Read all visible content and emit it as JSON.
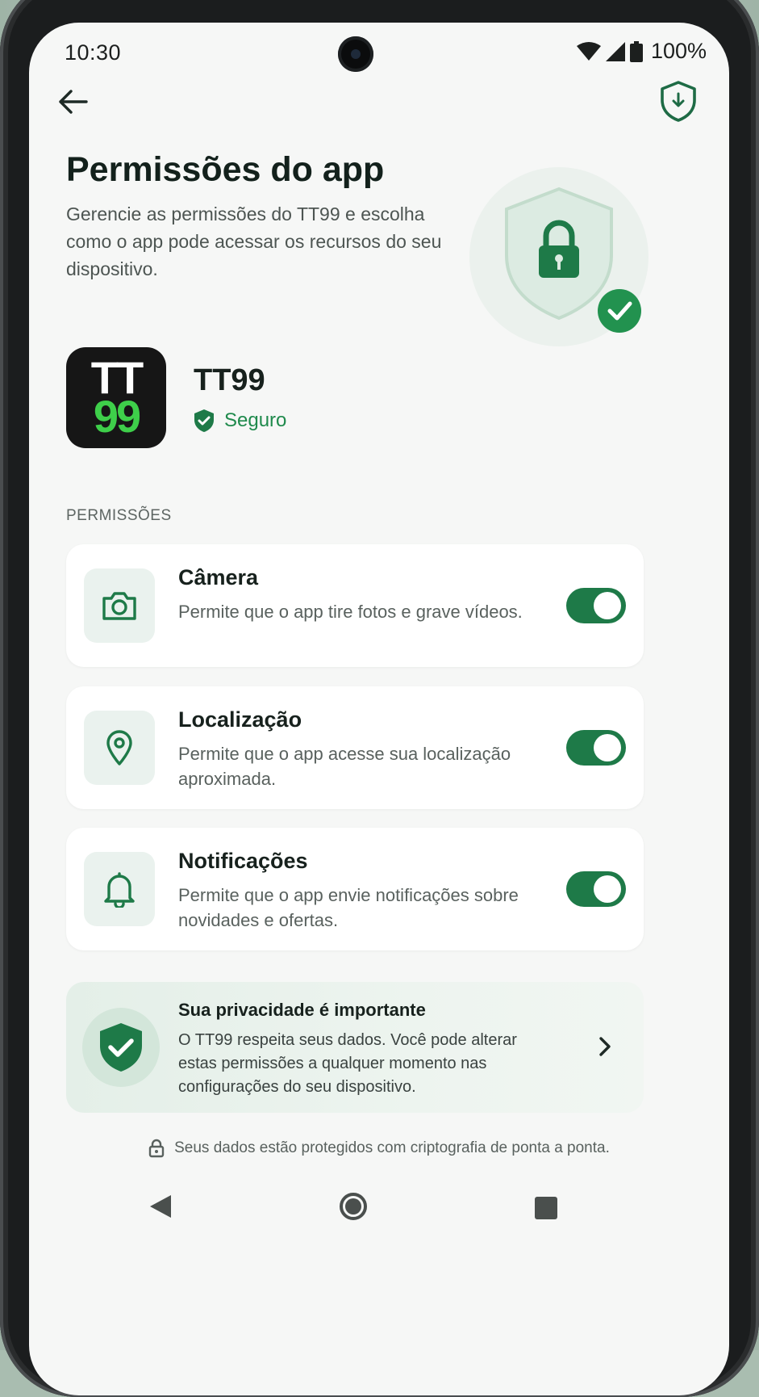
{
  "status_bar": {
    "time": "10:30",
    "battery": "100%"
  },
  "header": {
    "title": "Permissões do app",
    "subtitle": "Gerencie as permissões do TT99 e escolha como o app pode acessar os recursos do seu dispositivo."
  },
  "app": {
    "icon_line1": "TT",
    "icon_line2": "99",
    "name": "TT99",
    "status": "Seguro"
  },
  "permissions": {
    "section_label": "PERMISSÕES",
    "items": [
      {
        "title": "Câmera",
        "description": "Permite que o app tire fotos e grave vídeos.",
        "icon": "camera-icon",
        "enabled": true
      },
      {
        "title": "Localização",
        "description": "Permite que o app acesse sua localização aproximada.",
        "icon": "location-pin-icon",
        "enabled": true
      },
      {
        "title": "Notificações",
        "description": "Permite que o app envie notificações sobre novidades e ofertas.",
        "icon": "bell-icon",
        "enabled": true
      }
    ]
  },
  "privacy": {
    "title": "Sua privacidade é importante",
    "description": "O TT99 respeita seus dados. Você pode alterar estas permissões a qualquer momento nas configurações do seu dispositivo."
  },
  "footnote": "Seus dados estão protegidos com criptografia de ponta a ponta.",
  "colors": {
    "accent": "#1e7a48",
    "safe_text": "#1f8a4c",
    "app_icon_green": "#3ecf4a"
  }
}
